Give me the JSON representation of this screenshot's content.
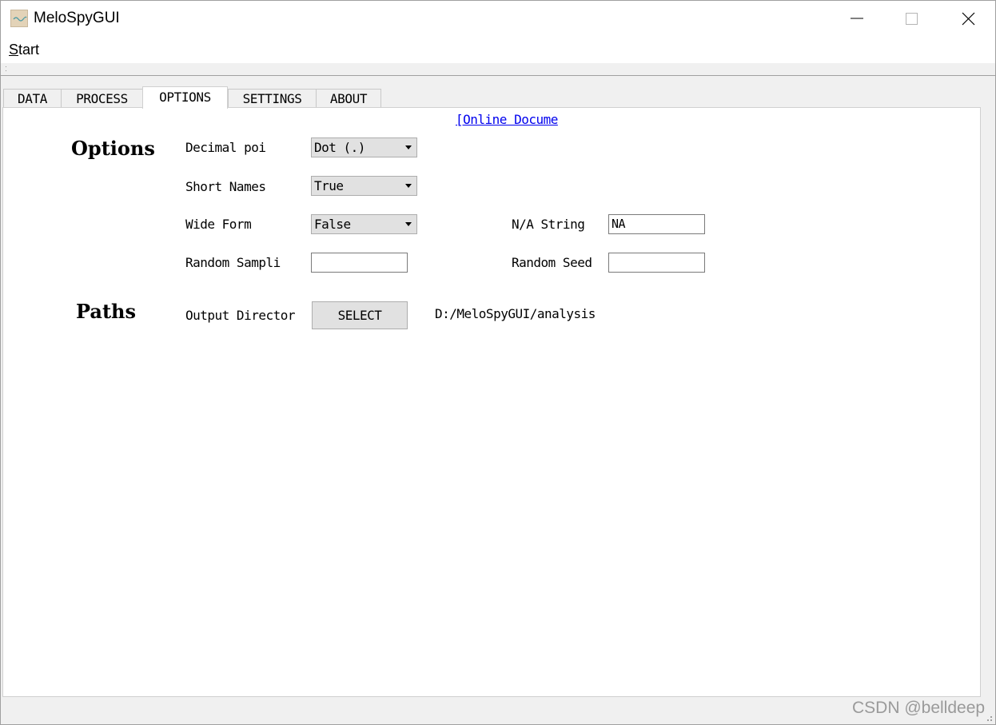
{
  "window": {
    "title": "MeloSpyGUI",
    "icon": "melospy-app-icon"
  },
  "menu": {
    "items": [
      {
        "label": "tart",
        "accel": "S"
      }
    ]
  },
  "tabs": [
    {
      "label": "DATA",
      "active": false
    },
    {
      "label": "PROCESS",
      "active": false
    },
    {
      "label": "OPTIONS",
      "active": true
    },
    {
      "label": "SETTINGS",
      "active": false
    },
    {
      "label": "ABOUT",
      "active": false
    }
  ],
  "panel": {
    "doc_link": "[Online Docume",
    "options": {
      "title": "Options",
      "decimal_point": {
        "label": "Decimal poi",
        "value": "Dot (.)"
      },
      "short_names": {
        "label": "Short Names",
        "value": "True"
      },
      "wide_form": {
        "label": "Wide Form",
        "value": "False"
      },
      "na_string": {
        "label": "N/A String",
        "value": "NA"
      },
      "random_sampling": {
        "label": "Random Sampli",
        "value": ""
      },
      "random_seed": {
        "label": "Random Seed",
        "value": ""
      }
    },
    "paths": {
      "title": "Paths",
      "output_directory": {
        "label": "Output Director",
        "button": "SELECT",
        "value": "D:/MeloSpyGUI/analysis"
      }
    }
  },
  "watermark": "CSDN @belldeep",
  "colors": {
    "link": "#0000ee",
    "button_face": "#e1e1e1",
    "window_bg": "#f0f0f0",
    "panel_bg": "#ffffff"
  }
}
